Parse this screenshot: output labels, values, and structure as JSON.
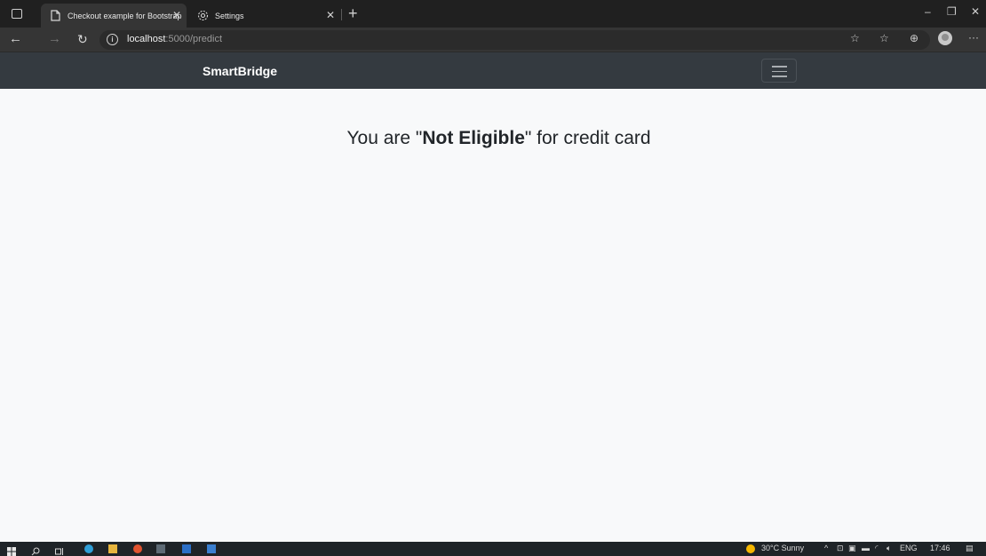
{
  "browser": {
    "tabs": [
      {
        "title": "Checkout example for Bootstrap",
        "icon": "page-icon",
        "active": true
      },
      {
        "title": "Settings",
        "icon": "gear-icon",
        "active": false
      }
    ],
    "address": {
      "host": "localhost",
      "path": ":5000/predict"
    }
  },
  "navbar": {
    "brand": "SmartBridge"
  },
  "main": {
    "prefix": "You are \"",
    "status": "Not Eligible",
    "suffix": "\" for credit card"
  },
  "taskbar": {
    "weather": "30°C  Sunny",
    "language": "ENG",
    "time": "17:46"
  },
  "colors": {
    "navbar_bg": "#343a40",
    "page_bg": "#f8f9fa",
    "browser_dark": "#202020",
    "taskbar_bg": "#1f2428"
  }
}
